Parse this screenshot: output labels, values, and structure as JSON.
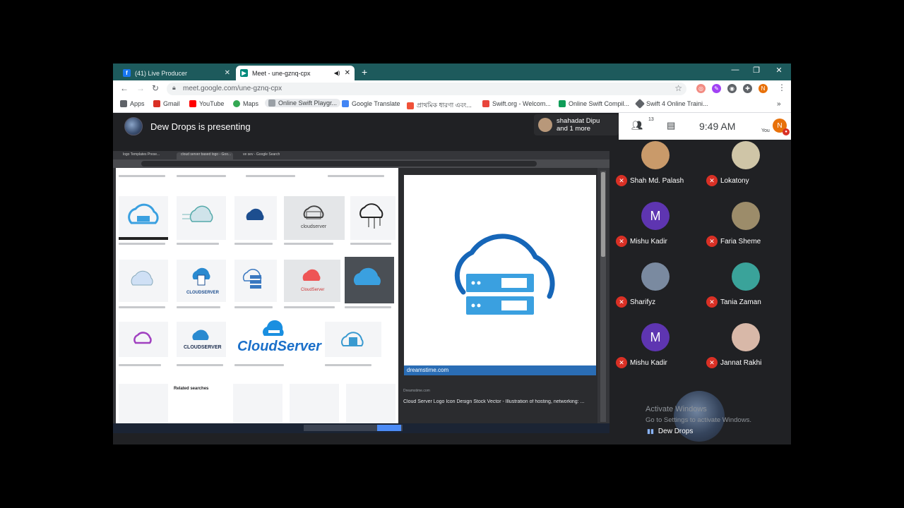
{
  "browser": {
    "tabs": [
      {
        "title": "(41) Live Producer",
        "favicon": "facebook-icon",
        "color": "#1877f2",
        "active": false
      },
      {
        "title": "Meet - une-gznq-cpx",
        "favicon": "meet-icon",
        "color": "#00897b",
        "active": true
      }
    ],
    "new_tab": "+",
    "url": "meet.google.com/une-gznq-cpx",
    "profile_initial": "N"
  },
  "bookmarks": [
    {
      "label": "Apps",
      "icon": "apps-icon",
      "color": "#5f6368"
    },
    {
      "label": "Gmail",
      "icon": "gmail-icon",
      "color": "#d93025"
    },
    {
      "label": "YouTube",
      "icon": "youtube-icon",
      "color": "#ff0000"
    },
    {
      "label": "Maps",
      "icon": "maps-icon",
      "color": "#34a853"
    },
    {
      "label": "Online Swift Playgr...",
      "icon": "swift-playground-icon",
      "color": "#9aa0a6"
    },
    {
      "label": "Google Translate",
      "icon": "translate-icon",
      "color": "#4285f4"
    },
    {
      "label": "প্রাথমিক ধারণা এবং...",
      "icon": "swift-icon",
      "color": "#f05138"
    },
    {
      "label": "Swift.org - Welcom...",
      "icon": "swift-org-icon",
      "color": "#e8453c"
    },
    {
      "label": "Online Swift Compil...",
      "icon": "code-icon",
      "color": "#0f9d58"
    },
    {
      "label": "Swift 4 Online Traini...",
      "icon": "training-icon",
      "color": "#5f6368"
    }
  ],
  "meet": {
    "presenting": "Dew Drops is presenting",
    "call_box_line1": "shahadat Dipu",
    "call_box_line2": "and 1 more",
    "participant_count": "13",
    "time": "9:49 AM",
    "you_label": "You",
    "self_initial": "N",
    "participants": [
      {
        "name": "Shah Md. Palash",
        "initial": "",
        "avatar_color": "#c99a6a"
      },
      {
        "name": "Lokatony",
        "initial": "",
        "avatar_color": "#cfc5a7"
      },
      {
        "name": "Mishu Kadir",
        "initial": "M",
        "avatar_color": "#5e35b1"
      },
      {
        "name": "Faria Sheme",
        "initial": "",
        "avatar_color": "#9c8c6a"
      },
      {
        "name": "Sharifyz",
        "initial": "",
        "avatar_color": "#7a8aa0"
      },
      {
        "name": "Tania Zaman",
        "initial": "",
        "avatar_color": "#3aa39a"
      },
      {
        "name": "Mishu Kadir",
        "initial": "M",
        "avatar_color": "#5e35b1"
      },
      {
        "name": "Jannat Rakhi",
        "initial": "",
        "avatar_color": "#d8b8a8"
      }
    ],
    "activate_line1": "Activate Windows",
    "activate_line2": "Go to Settings to activate Windows.",
    "self_name": "Dew Drops"
  },
  "shared_screen": {
    "tabs": [
      "logo Templates Prese...",
      "cloud server based logo - Goo...",
      "ve sev - Google Search"
    ],
    "cloudserver_text": "CloudServer",
    "watermark": "dreamstime.com",
    "source": "Dreamstime.com",
    "caption": "Cloud Server Logo Icon Design Stock Vector - Illustration of hosting, networking: ...",
    "related": "Related searches"
  }
}
